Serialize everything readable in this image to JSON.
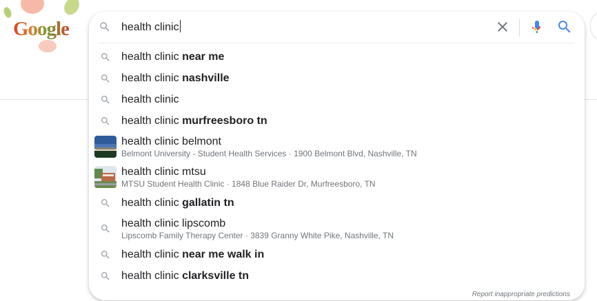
{
  "logo": {
    "text": "Google"
  },
  "search": {
    "query": "health clinic"
  },
  "suggestions": [
    {
      "type": "query",
      "prefix": "health clinic",
      "completion": "near me"
    },
    {
      "type": "query",
      "prefix": "health clinic",
      "completion": "nashville"
    },
    {
      "type": "query",
      "prefix": "health clinic",
      "completion": ""
    },
    {
      "type": "query",
      "prefix": "health clinic",
      "completion": "murfreesboro tn"
    },
    {
      "type": "entity",
      "title": "health clinic belmont",
      "subtitle": "Belmont University - Student Health Services · 1900 Belmont Blvd, Nashville, TN",
      "thumb": "belmont-building"
    },
    {
      "type": "entity",
      "title": "health clinic mtsu",
      "subtitle": "MTSU Student Health Clinic · 1848 Blue Raider Dr, Murfreesboro, TN",
      "thumb": "mtsu-building"
    },
    {
      "type": "query",
      "prefix": "health clinic",
      "completion": "gallatin tn"
    },
    {
      "type": "entity-noimg",
      "title": "health clinic lipscomb",
      "subtitle": "Lipscomb Family Therapy Center · 3839 Granny White Pike, Nashville, TN"
    },
    {
      "type": "query",
      "prefix": "health clinic",
      "completion": "near me walk in"
    },
    {
      "type": "query",
      "prefix": "health clinic",
      "completion": "clarksville tn"
    }
  ],
  "report_link": "Report inappropriate predictions",
  "colors": {
    "accent_blue": "#4285f4",
    "mic_red": "#ea4335",
    "mic_yellow": "#fbbc04",
    "mic_green": "#34a853",
    "icon_gray": "#9aa0a6"
  }
}
